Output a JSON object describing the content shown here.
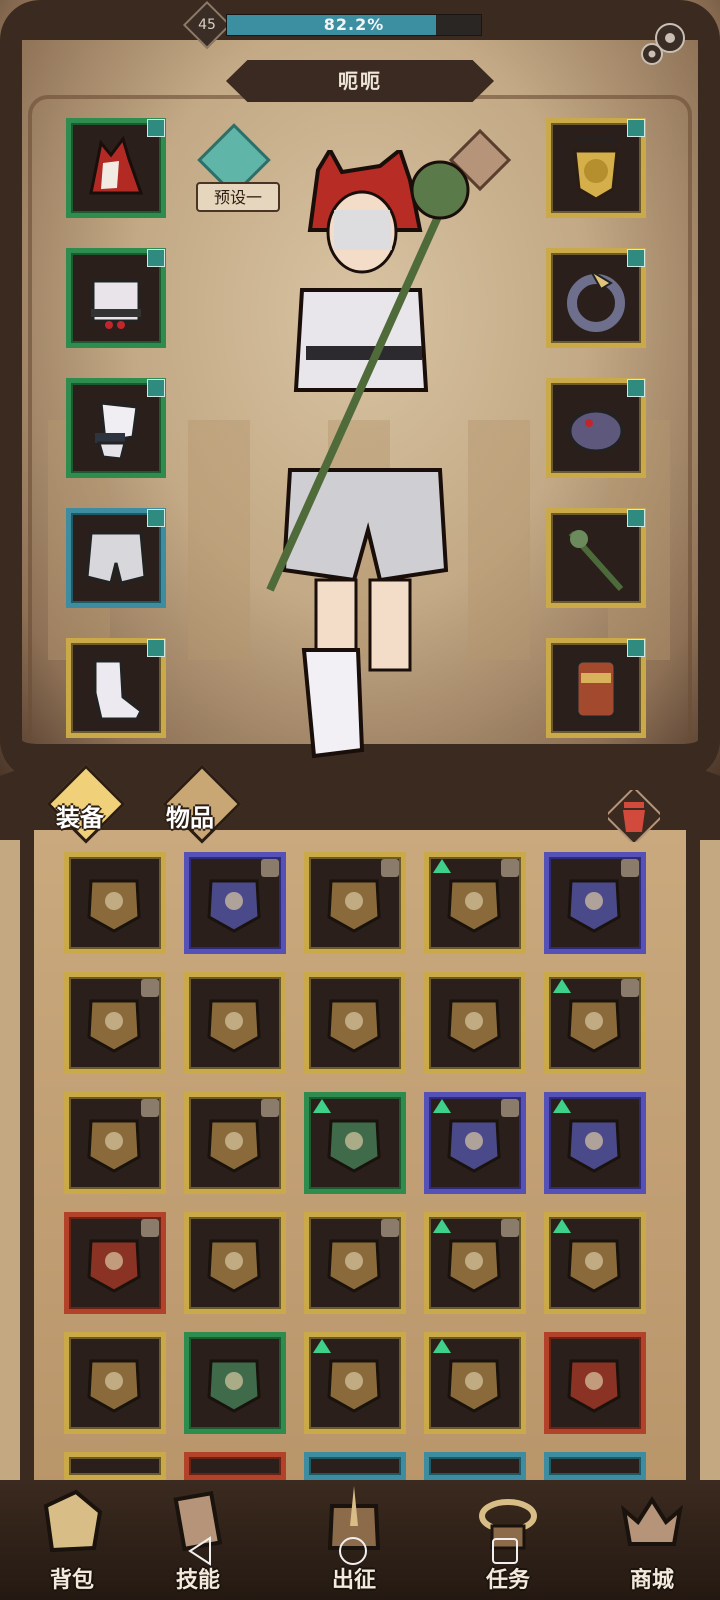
{
  "player": {
    "level": "45",
    "xp_text": "82.2%",
    "xp_fraction": 0.822
  },
  "character": {
    "name": "呃呃",
    "preset_label": "预设一"
  },
  "equipment": {
    "left": [
      "hood",
      "chest-ruffle",
      "arm-ruffle",
      "bloomers",
      "shoes"
    ],
    "right": [
      "lion-amulet",
      "horn-ring",
      "spider-gem",
      "vine-staff",
      "gauntlet"
    ]
  },
  "inventory": {
    "tabs": [
      {
        "label": "装备",
        "selected": true
      },
      {
        "label": "物品",
        "selected": false
      }
    ],
    "rows": [
      [
        {
          "rarity": "gold",
          "locked": false,
          "upgrade": false,
          "item": "heart-necklace"
        },
        {
          "rarity": "purple",
          "locked": true,
          "upgrade": false,
          "item": "cross-necklace"
        },
        {
          "rarity": "gold",
          "locked": true,
          "upgrade": false,
          "item": "chain-lantern"
        },
        {
          "rarity": "gold",
          "locked": true,
          "upgrade": true,
          "item": "chain-charm"
        },
        {
          "rarity": "purple",
          "locked": true,
          "upgrade": false,
          "item": "gem-ring"
        }
      ],
      [
        {
          "rarity": "gold",
          "locked": true,
          "upgrade": false,
          "item": "red-armor"
        },
        {
          "rarity": "gold",
          "locked": false,
          "upgrade": false,
          "item": "dark-wand"
        },
        {
          "rarity": "gold",
          "locked": false,
          "upgrade": false,
          "item": "iron-helm"
        },
        {
          "rarity": "gold",
          "locked": false,
          "upgrade": false,
          "item": "thorn-staff"
        },
        {
          "rarity": "gold",
          "locked": true,
          "upgrade": true,
          "item": "beast-mask"
        }
      ],
      [
        {
          "rarity": "gold",
          "locked": true,
          "upgrade": false,
          "item": "red-cloak"
        },
        {
          "rarity": "gold",
          "locked": true,
          "upgrade": false,
          "item": "lion-amulet"
        },
        {
          "rarity": "green",
          "locked": false,
          "upgrade": true,
          "item": "shadow-coat"
        },
        {
          "rarity": "purple",
          "locked": true,
          "upgrade": true,
          "item": "purple-gauntlet"
        },
        {
          "rarity": "purple",
          "locked": false,
          "upgrade": true,
          "item": "black-gauntlet"
        }
      ],
      [
        {
          "rarity": "red",
          "locked": true,
          "upgrade": false,
          "item": "cross-shield"
        },
        {
          "rarity": "gold",
          "locked": false,
          "upgrade": false,
          "item": "vine-staff"
        },
        {
          "rarity": "gold",
          "locked": true,
          "upgrade": false,
          "item": "iron-boots"
        },
        {
          "rarity": "gold",
          "locked": true,
          "upgrade": true,
          "item": "dark-pants"
        },
        {
          "rarity": "gold",
          "locked": false,
          "upgrade": true,
          "item": "crimson-gauntlet"
        }
      ],
      [
        {
          "rarity": "gold",
          "locked": false,
          "upgrade": false,
          "item": "gold-boots"
        },
        {
          "rarity": "green",
          "locked": false,
          "upgrade": false,
          "item": "ruffle-top"
        },
        {
          "rarity": "gold",
          "locked": false,
          "upgrade": true,
          "item": "compass-book"
        },
        {
          "rarity": "gold",
          "locked": false,
          "upgrade": true,
          "item": "blue-coat"
        },
        {
          "rarity": "red",
          "locked": false,
          "upgrade": false,
          "item": "demon-mask"
        }
      ]
    ]
  },
  "nav": [
    {
      "label": "背包",
      "icon": "backpack-icon"
    },
    {
      "label": "技能",
      "icon": "skill-card-icon"
    },
    {
      "label": "出征",
      "icon": "sword-flag-icon"
    },
    {
      "label": "任务",
      "icon": "quest-ring-icon"
    },
    {
      "label": "商城",
      "icon": "shop-crown-icon"
    }
  ],
  "colors": {
    "xp": "#3b8fa1",
    "rarity_gold": "#c9a948",
    "rarity_green": "#2e8d4e",
    "rarity_purple": "#5651b6",
    "rarity_red": "#b2432a",
    "rarity_teal": "#3e8ca0",
    "upgrade": "#3fd08a"
  }
}
